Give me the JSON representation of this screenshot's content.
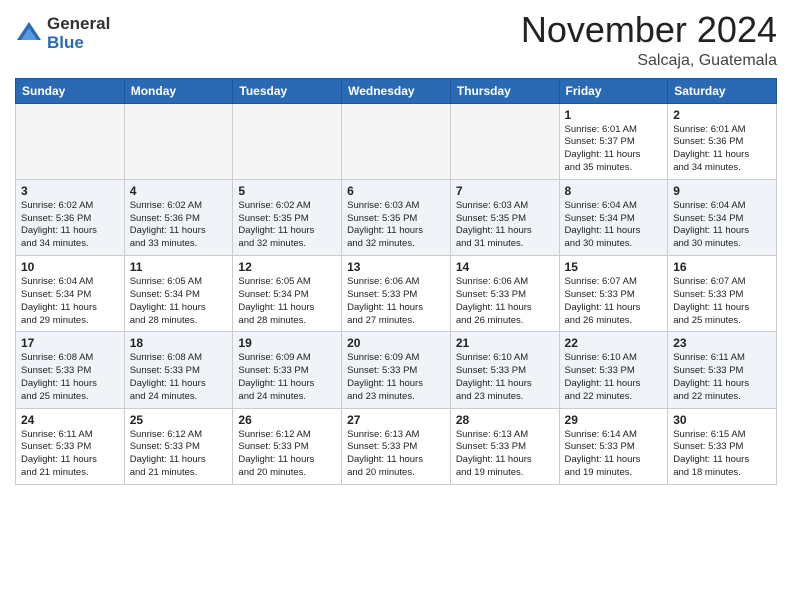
{
  "header": {
    "logo_general": "General",
    "logo_blue": "Blue",
    "month_title": "November 2024",
    "location": "Salcaja, Guatemala"
  },
  "days_of_week": [
    "Sunday",
    "Monday",
    "Tuesday",
    "Wednesday",
    "Thursday",
    "Friday",
    "Saturday"
  ],
  "weeks": [
    [
      {
        "day": "",
        "info": ""
      },
      {
        "day": "",
        "info": ""
      },
      {
        "day": "",
        "info": ""
      },
      {
        "day": "",
        "info": ""
      },
      {
        "day": "",
        "info": ""
      },
      {
        "day": "1",
        "info": "Sunrise: 6:01 AM\nSunset: 5:37 PM\nDaylight: 11 hours\nand 35 minutes."
      },
      {
        "day": "2",
        "info": "Sunrise: 6:01 AM\nSunset: 5:36 PM\nDaylight: 11 hours\nand 34 minutes."
      }
    ],
    [
      {
        "day": "3",
        "info": "Sunrise: 6:02 AM\nSunset: 5:36 PM\nDaylight: 11 hours\nand 34 minutes."
      },
      {
        "day": "4",
        "info": "Sunrise: 6:02 AM\nSunset: 5:36 PM\nDaylight: 11 hours\nand 33 minutes."
      },
      {
        "day": "5",
        "info": "Sunrise: 6:02 AM\nSunset: 5:35 PM\nDaylight: 11 hours\nand 32 minutes."
      },
      {
        "day": "6",
        "info": "Sunrise: 6:03 AM\nSunset: 5:35 PM\nDaylight: 11 hours\nand 32 minutes."
      },
      {
        "day": "7",
        "info": "Sunrise: 6:03 AM\nSunset: 5:35 PM\nDaylight: 11 hours\nand 31 minutes."
      },
      {
        "day": "8",
        "info": "Sunrise: 6:04 AM\nSunset: 5:34 PM\nDaylight: 11 hours\nand 30 minutes."
      },
      {
        "day": "9",
        "info": "Sunrise: 6:04 AM\nSunset: 5:34 PM\nDaylight: 11 hours\nand 30 minutes."
      }
    ],
    [
      {
        "day": "10",
        "info": "Sunrise: 6:04 AM\nSunset: 5:34 PM\nDaylight: 11 hours\nand 29 minutes."
      },
      {
        "day": "11",
        "info": "Sunrise: 6:05 AM\nSunset: 5:34 PM\nDaylight: 11 hours\nand 28 minutes."
      },
      {
        "day": "12",
        "info": "Sunrise: 6:05 AM\nSunset: 5:34 PM\nDaylight: 11 hours\nand 28 minutes."
      },
      {
        "day": "13",
        "info": "Sunrise: 6:06 AM\nSunset: 5:33 PM\nDaylight: 11 hours\nand 27 minutes."
      },
      {
        "day": "14",
        "info": "Sunrise: 6:06 AM\nSunset: 5:33 PM\nDaylight: 11 hours\nand 26 minutes."
      },
      {
        "day": "15",
        "info": "Sunrise: 6:07 AM\nSunset: 5:33 PM\nDaylight: 11 hours\nand 26 minutes."
      },
      {
        "day": "16",
        "info": "Sunrise: 6:07 AM\nSunset: 5:33 PM\nDaylight: 11 hours\nand 25 minutes."
      }
    ],
    [
      {
        "day": "17",
        "info": "Sunrise: 6:08 AM\nSunset: 5:33 PM\nDaylight: 11 hours\nand 25 minutes."
      },
      {
        "day": "18",
        "info": "Sunrise: 6:08 AM\nSunset: 5:33 PM\nDaylight: 11 hours\nand 24 minutes."
      },
      {
        "day": "19",
        "info": "Sunrise: 6:09 AM\nSunset: 5:33 PM\nDaylight: 11 hours\nand 24 minutes."
      },
      {
        "day": "20",
        "info": "Sunrise: 6:09 AM\nSunset: 5:33 PM\nDaylight: 11 hours\nand 23 minutes."
      },
      {
        "day": "21",
        "info": "Sunrise: 6:10 AM\nSunset: 5:33 PM\nDaylight: 11 hours\nand 23 minutes."
      },
      {
        "day": "22",
        "info": "Sunrise: 6:10 AM\nSunset: 5:33 PM\nDaylight: 11 hours\nand 22 minutes."
      },
      {
        "day": "23",
        "info": "Sunrise: 6:11 AM\nSunset: 5:33 PM\nDaylight: 11 hours\nand 22 minutes."
      }
    ],
    [
      {
        "day": "24",
        "info": "Sunrise: 6:11 AM\nSunset: 5:33 PM\nDaylight: 11 hours\nand 21 minutes."
      },
      {
        "day": "25",
        "info": "Sunrise: 6:12 AM\nSunset: 5:33 PM\nDaylight: 11 hours\nand 21 minutes."
      },
      {
        "day": "26",
        "info": "Sunrise: 6:12 AM\nSunset: 5:33 PM\nDaylight: 11 hours\nand 20 minutes."
      },
      {
        "day": "27",
        "info": "Sunrise: 6:13 AM\nSunset: 5:33 PM\nDaylight: 11 hours\nand 20 minutes."
      },
      {
        "day": "28",
        "info": "Sunrise: 6:13 AM\nSunset: 5:33 PM\nDaylight: 11 hours\nand 19 minutes."
      },
      {
        "day": "29",
        "info": "Sunrise: 6:14 AM\nSunset: 5:33 PM\nDaylight: 11 hours\nand 19 minutes."
      },
      {
        "day": "30",
        "info": "Sunrise: 6:15 AM\nSunset: 5:33 PM\nDaylight: 11 hours\nand 18 minutes."
      }
    ]
  ]
}
